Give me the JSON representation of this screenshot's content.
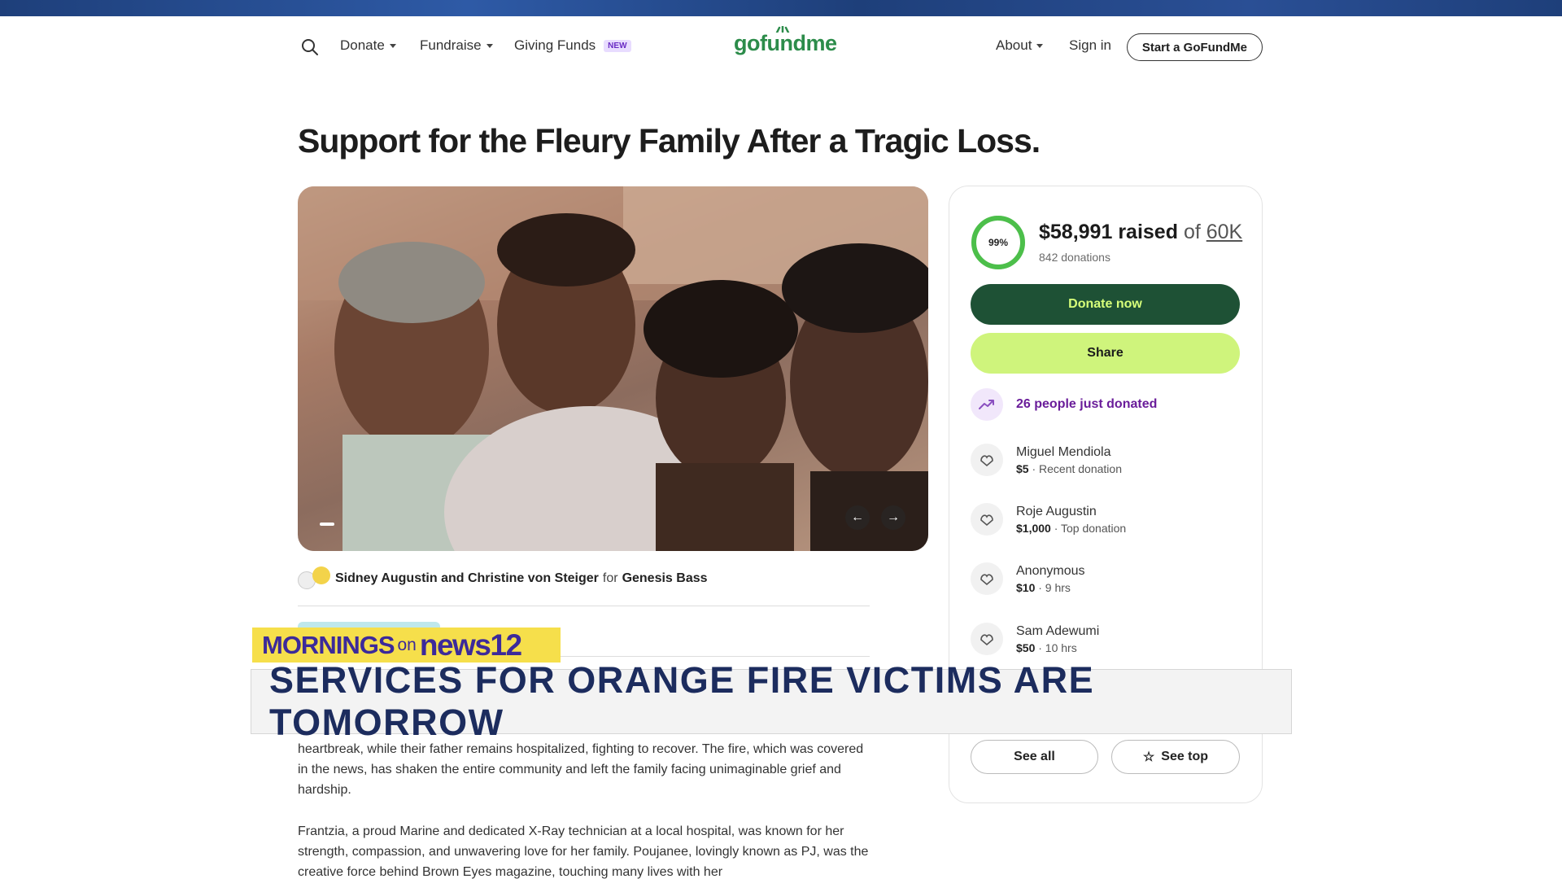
{
  "nav": {
    "donate": "Donate",
    "fundraise": "Fundraise",
    "giving_funds": "Giving Funds",
    "new_badge": "NEW",
    "logo": "gofundme",
    "about": "About",
    "sign_in": "Sign in",
    "start": "Start a GoFundMe"
  },
  "campaign": {
    "title": "Support for the Fleury Family After a Tragic Loss.",
    "organizers": "Sidney Augustin and Christine von Steiger",
    "for_label": "for",
    "beneficiary": "Genesis Bass"
  },
  "progress": {
    "percent_label": "99%",
    "fraction": 0.99,
    "raised": "$58,991 raised",
    "of": "of",
    "goal": "60K",
    "donations": "842 donations"
  },
  "buttons": {
    "donate_now": "Donate now",
    "share": "Share",
    "see_all": "See all",
    "see_top": "See top"
  },
  "trend": "26 people just donated",
  "donors": [
    {
      "name": "Miguel Mendiola",
      "amount": "$5",
      "note": " · Recent donation"
    },
    {
      "name": "Roje Augustin",
      "amount": "$1,000",
      "note": " · Top donation"
    },
    {
      "name": "Anonymous",
      "amount": "$10",
      "note": " · 9 hrs"
    },
    {
      "name": "Sam Adewumi",
      "amount": "$50",
      "note": " · 10 hrs"
    }
  ],
  "story": [
    "heartbreak, while their father remains hospitalized, fighting to recover. The fire, which was covered in the news, has shaken the entire community and left the family facing unimaginable grief and hardship.",
    "Frantzia, a proud Marine and dedicated X-Ray technician at a local hospital, was known for her strength, compassion, and unwavering love for her family. Poujanee, lovingly known as PJ, was the creative force behind Brown Eyes magazine, touching many lives with her"
  ],
  "broadcast": {
    "mornings": "MORNINGS",
    "on": "on",
    "news": "news12",
    "headline": "SERVICES FOR ORANGE FIRE VICTIMS ARE TOMORROW"
  },
  "colors": {
    "donate_bg": "#1e5135",
    "share_bg": "#cff47c",
    "ring": "#4cbf4a",
    "banner_text": "#1c2c5e",
    "brand_bg": "#f6df4b"
  }
}
